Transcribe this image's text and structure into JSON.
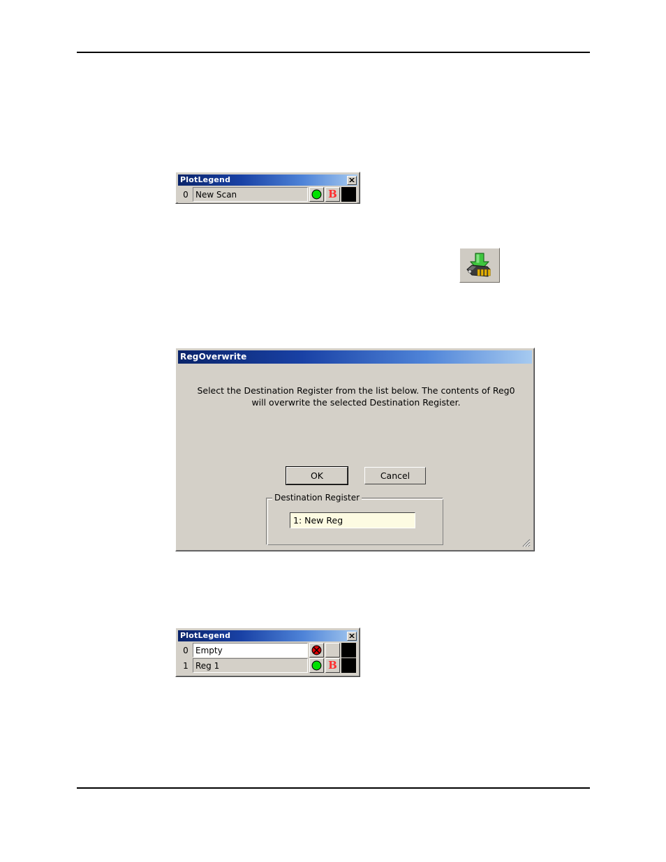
{
  "page": {
    "header_rule": true,
    "footer_rule": true
  },
  "plot_legend_top": {
    "title": "PlotLegend",
    "close_icon": "close-icon",
    "rows": [
      {
        "index": "0",
        "name": "New Scan",
        "name_bg": "grey",
        "status_icon": "green-circle-icon",
        "status_color": "#00e000",
        "bold_label": "B",
        "bold_color": "#ff2d2d",
        "swatch_color": "#000000"
      }
    ]
  },
  "toolbar_icon": {
    "name": "overwrite-register-icon",
    "description": "green down arrow over connector",
    "arrow_color": "#3fbf3f",
    "connector_color": "#e8b200"
  },
  "reg_dialog": {
    "title": "RegOverwrite",
    "close_icon": "close-icon",
    "message_line1": "Select the Destination Register from the list below. The contents of Reg0",
    "message_line2": "will overwrite the selected Destination Register.",
    "ok_label": "OK",
    "cancel_label": "Cancel",
    "group_title": "Destination Register",
    "listbox_selected": "1: New Reg",
    "listbox_bg": "#fdfbe2",
    "resize_grip_icon": "resize-grip-icon"
  },
  "plot_legend_bottom": {
    "title": "PlotLegend",
    "close_icon": "close-icon",
    "rows": [
      {
        "index": "0",
        "name": "Empty",
        "name_bg": "white",
        "status_icon": "red-circle-x-icon",
        "status_color": "#e00000",
        "bold_label": "",
        "bold_color": "#ff2d2d",
        "swatch_color": "#000000"
      },
      {
        "index": "1",
        "name": "Reg 1",
        "name_bg": "grey",
        "status_icon": "green-circle-icon",
        "status_color": "#00e000",
        "bold_label": "B",
        "bold_color": "#ff2d2d",
        "swatch_color": "#000000"
      }
    ]
  }
}
